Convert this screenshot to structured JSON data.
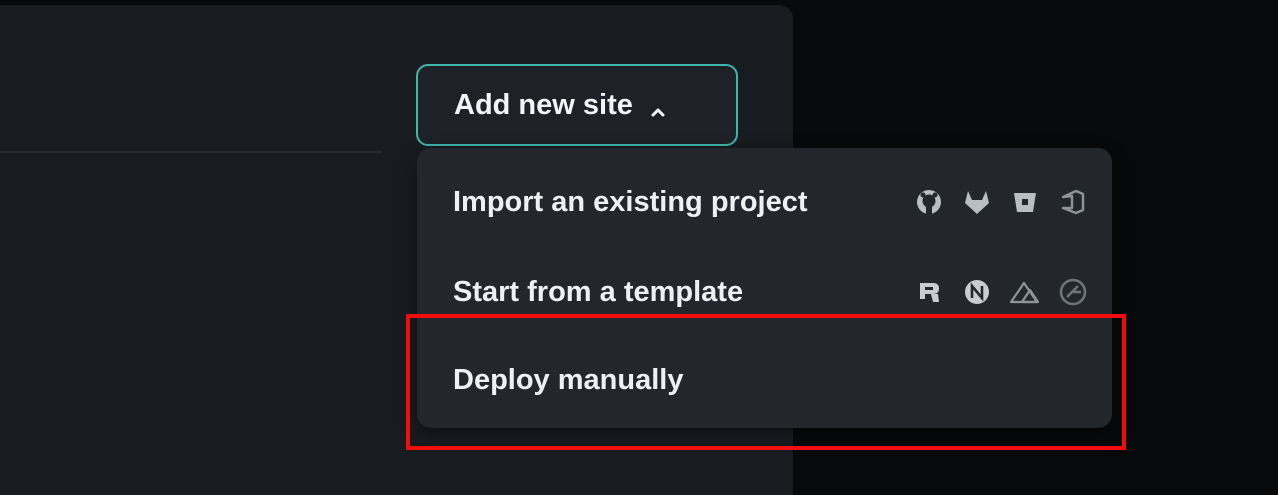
{
  "add_site_button": {
    "label": "Add new site",
    "border_color": "#3fb6ac"
  },
  "menu": {
    "items": [
      {
        "label": "Import an existing project",
        "icons": [
          "github-icon",
          "gitlab-icon",
          "bitbucket-icon",
          "azure-devops-icon"
        ]
      },
      {
        "label": "Start from a template",
        "icons": [
          "remix-icon",
          "nextjs-icon",
          "nuxt-icon",
          "gatsby-icon"
        ]
      },
      {
        "label": "Deploy manually",
        "icons": []
      }
    ]
  },
  "highlight": {
    "color": "#f20d0d",
    "target": "Deploy manually"
  }
}
